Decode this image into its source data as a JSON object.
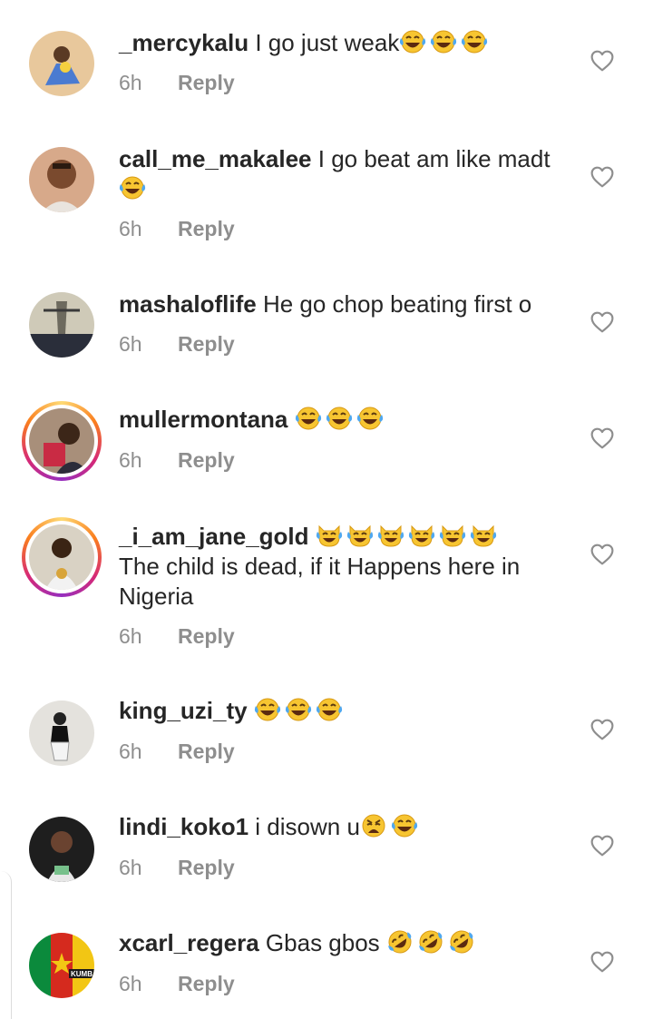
{
  "comments": [
    {
      "username": "_mercykalu",
      "text": "I go just weak",
      "time": "6h",
      "reply": "Reply",
      "emojis": [
        "joy-emoji",
        "joy-emoji",
        "joy-emoji"
      ]
    },
    {
      "username": "call_me_makalee",
      "text": "I go beat am like madt",
      "time": "6h",
      "reply": "Reply",
      "emojis": [
        "joy-emoji"
      ]
    },
    {
      "username": "mashaloflife",
      "text": "He go chop beating first o",
      "time": "6h",
      "reply": "Reply",
      "emojis": []
    },
    {
      "username": "mullermontana",
      "text": "",
      "time": "6h",
      "reply": "Reply",
      "emojis": [
        "joy-emoji",
        "joy-emoji",
        "joy-emoji"
      ]
    },
    {
      "username": "_i_am_jane_gold",
      "text": "The child is dead, if it Happens here in Nigeria",
      "time": "6h",
      "reply": "Reply",
      "emojis": [
        "joy-cat-emoji",
        "joy-cat-emoji",
        "joy-cat-emoji",
        "joy-cat-emoji",
        "joy-cat-emoji",
        "joy-cat-emoji"
      ]
    },
    {
      "username": "king_uzi_ty",
      "text": "",
      "time": "6h",
      "reply": "Reply",
      "emojis": [
        "joy-emoji",
        "joy-emoji",
        "joy-emoji"
      ]
    },
    {
      "username": "lindi_koko1",
      "text": "i disown u",
      "time": "6h",
      "reply": "Reply",
      "emojis": [
        "weary-emoji",
        "joy-emoji"
      ]
    },
    {
      "username": "xcarl_regera",
      "text": "Gbas gbos",
      "time": "6h",
      "reply": "Reply",
      "emojis": [
        "rofl-emoji",
        "rofl-emoji",
        "rofl-emoji"
      ]
    }
  ],
  "avatars": {
    "c5_caption": "KUMBA"
  },
  "colors": {
    "text": "#262626",
    "meta": "#8e8e8e",
    "joy_face": "#f7c531",
    "tears": "#4fa8f0",
    "story_ring": "#d62976"
  }
}
